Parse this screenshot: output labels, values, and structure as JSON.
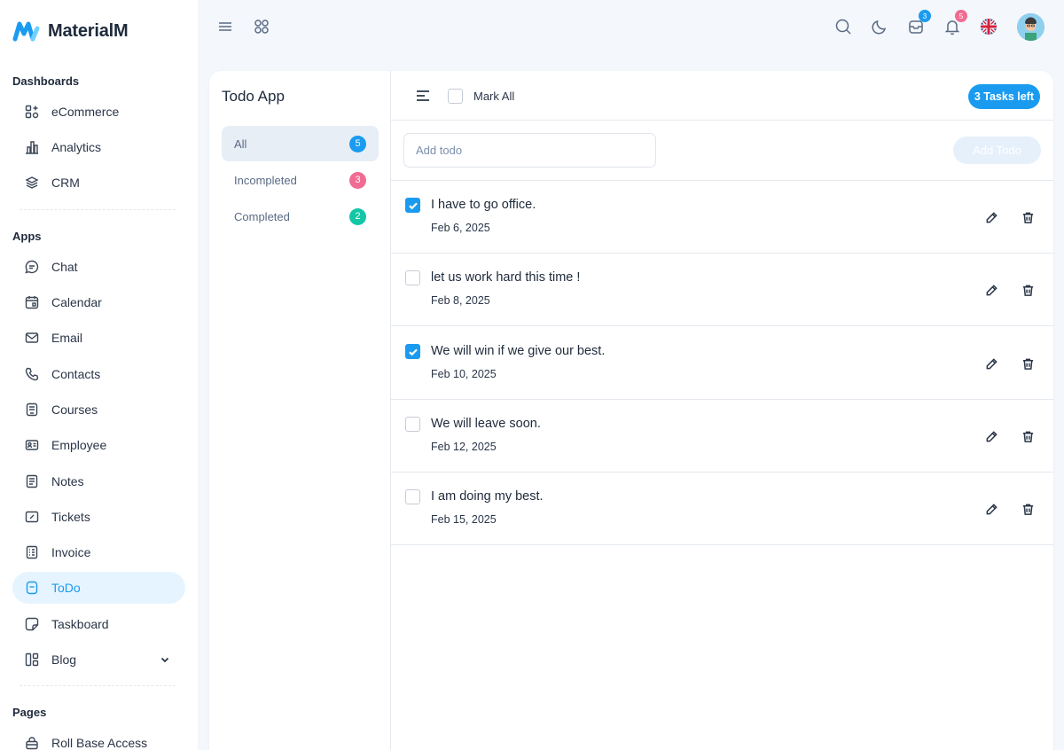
{
  "brand": {
    "name": "MaterialM"
  },
  "sidebar": {
    "sections": [
      {
        "title": "Dashboards"
      },
      {
        "title": "Apps"
      },
      {
        "title": "Pages"
      }
    ],
    "items": [
      {
        "label": "eCommerce",
        "icon": "ecommerce-icon"
      },
      {
        "label": "Analytics",
        "icon": "analytics-icon"
      },
      {
        "label": "CRM",
        "icon": "crm-icon"
      },
      {
        "label": "Chat",
        "icon": "chat-icon"
      },
      {
        "label": "Calendar",
        "icon": "calendar-icon"
      },
      {
        "label": "Email",
        "icon": "email-icon"
      },
      {
        "label": "Contacts",
        "icon": "phone-icon"
      },
      {
        "label": "Courses",
        "icon": "courses-icon"
      },
      {
        "label": "Employee",
        "icon": "employee-icon"
      },
      {
        "label": "Notes",
        "icon": "notes-icon"
      },
      {
        "label": "Tickets",
        "icon": "ticket-icon"
      },
      {
        "label": "Invoice",
        "icon": "invoice-icon"
      },
      {
        "label": "ToDo",
        "icon": "todo-icon",
        "active": true
      },
      {
        "label": "Taskboard",
        "icon": "taskboard-icon"
      },
      {
        "label": "Blog",
        "icon": "blog-icon"
      },
      {
        "label": "Roll Base Access",
        "icon": "lock-icon"
      }
    ]
  },
  "header": {
    "badges": {
      "messages": "3",
      "notifications": "5"
    },
    "colors": {
      "message_badge": "#1a9bf0",
      "notification_badge": "#f16b93"
    }
  },
  "todo": {
    "title": "Todo App",
    "filters": [
      {
        "label": "All",
        "count": "5",
        "color": "#1a9bf0"
      },
      {
        "label": "Incompleted",
        "count": "3",
        "color": "#f16b93"
      },
      {
        "label": "Completed",
        "count": "2",
        "color": "#13c7a6"
      }
    ],
    "mark_all_label": "Mark All",
    "tasks_left": "3 Tasks left",
    "add_placeholder": "Add todo",
    "add_button": "Add Todo",
    "items": [
      {
        "text": "I have to go office.",
        "date": "Feb 6, 2025",
        "done": true
      },
      {
        "text": "let us work hard this time !",
        "date": "Feb 8, 2025",
        "done": false
      },
      {
        "text": "We will win if we give our best.",
        "date": "Feb 10, 2025",
        "done": true
      },
      {
        "text": "We will leave soon.",
        "date": "Feb 12, 2025",
        "done": false
      },
      {
        "text": "I am doing my best.",
        "date": "Feb 15, 2025",
        "done": false
      }
    ]
  }
}
